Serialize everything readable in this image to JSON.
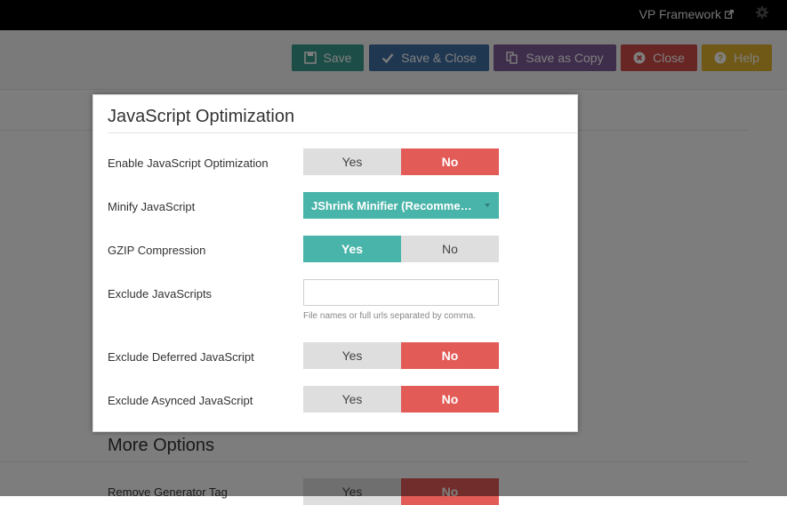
{
  "header": {
    "brand": "VP Framework",
    "brand_icon": "external-link-icon",
    "settings_icon": "gear-icon"
  },
  "toolbar": {
    "buttons": [
      {
        "label": "Save",
        "icon": "floppy-disk-icon",
        "color": "#3a9a8f"
      },
      {
        "label": "Save & Close",
        "icon": "checkmark-icon",
        "color": "#3e6fa3"
      },
      {
        "label": "Save as Copy",
        "icon": "copy-icon",
        "color": "#7d5b97"
      },
      {
        "label": "Close",
        "icon": "close-circle-icon",
        "color": "#cf4b47"
      },
      {
        "label": "Help",
        "icon": "question-circle-icon",
        "color": "#e0b02c"
      }
    ]
  },
  "colors": {
    "yes_active": "#49b4a9",
    "no_active": "#e35b57",
    "inactive": "#dedede"
  },
  "background": {
    "more_options_title": "More Options",
    "remove_generator_label": "Remove Generator Tag",
    "remove_generator_yes": "Yes",
    "remove_generator_no": "No",
    "remove_generator_value": "No"
  },
  "modal": {
    "title": "JavaScript Optimization",
    "fields": {
      "enable": {
        "label": "Enable JavaScript Optimization",
        "yes": "Yes",
        "no": "No",
        "value": "No"
      },
      "minify": {
        "label": "Minify JavaScript",
        "value": "JShrink Minifier (Recommended)"
      },
      "gzip": {
        "label": "GZIP Compression",
        "yes": "Yes",
        "no": "No",
        "value": "Yes"
      },
      "exclude": {
        "label": "Exclude JavaScripts",
        "value": "",
        "placeholder": "",
        "help": "File names or full urls separated by comma."
      },
      "deferred": {
        "label": "Exclude Deferred JavaScript",
        "yes": "Yes",
        "no": "No",
        "value": "No"
      },
      "asynced": {
        "label": "Exclude Asynced JavaScript",
        "yes": "Yes",
        "no": "No",
        "value": "No"
      }
    }
  }
}
